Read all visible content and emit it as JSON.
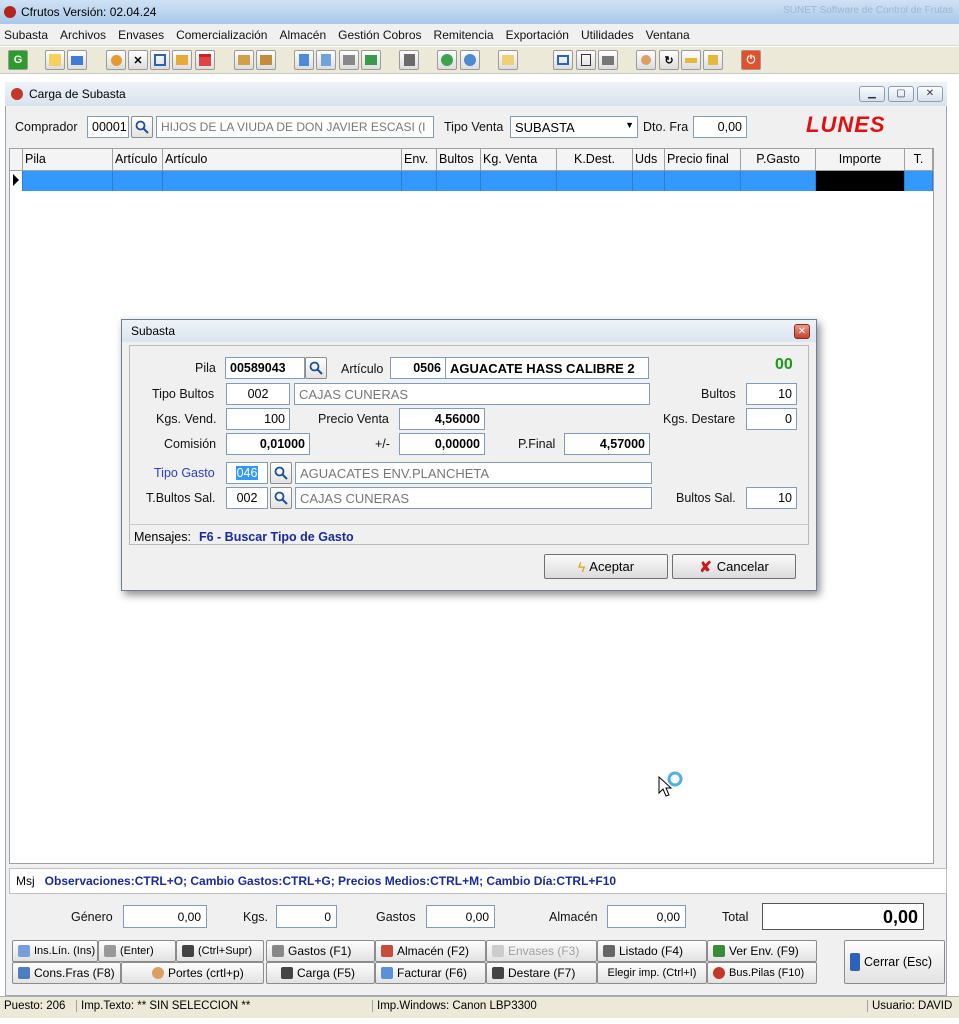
{
  "app": {
    "title": "Cfrutos Versión: 02.04.24",
    "faded_title": "SUNET Software de Control de Frutas"
  },
  "menu": [
    "Subasta",
    "Archivos",
    "Envases",
    "Comercialización",
    "Almacén",
    "Gestión Cobros",
    "Remitencia",
    "Exportación",
    "Utilidades",
    "Ventana"
  ],
  "window": {
    "title": "Carga de Subasta"
  },
  "header": {
    "comprador_label": "Comprador",
    "comprador_code": "00001",
    "comprador_name": "HIJOS DE LA VIUDA DE DON JAVIER ESCASI (I",
    "tipo_venta_label": "Tipo Venta",
    "tipo_venta_value": "SUBASTA",
    "dto_label": "Dto. Fra",
    "dto_value": "0,00",
    "day": "LUNES"
  },
  "grid": {
    "columns": [
      "Pila",
      "Artículo",
      "Artículo",
      "Env.",
      "Bultos",
      "Kg. Venta",
      "K.Dest.",
      "Uds",
      "Precio final",
      "P.Gasto",
      "Importe",
      "T."
    ]
  },
  "dialog": {
    "title": "Subasta",
    "close_glyph": "✕",
    "pila_label": "Pila",
    "pila_value": "00589043",
    "articulo_label": "Artículo",
    "articulo_code": "0506",
    "articulo_name": "AGUACATE HASS CALIBRE 2",
    "counter": "00",
    "tipo_bultos_label": "Tipo Bultos",
    "tipo_bultos_code": "002",
    "tipo_bultos_name": "CAJAS CUNERAS",
    "bultos_label": "Bultos",
    "bultos_value": "10",
    "kgs_vend_label": "Kgs. Vend.",
    "kgs_vend_value": "100",
    "precio_venta_label": "Precio Venta",
    "precio_venta_value": "4,56000",
    "kgs_destare_label": "Kgs. Destare",
    "kgs_destare_value": "0",
    "comision_label": "Comisión",
    "comision_value": "0,01000",
    "plusminus_label": "+/-",
    "plusminus_value": "0,00000",
    "pfinal_label": "P.Final",
    "pfinal_value": "4,57000",
    "tipo_gasto_label": "Tipo Gasto",
    "tipo_gasto_code": "046",
    "tipo_gasto_name": "AGUACATES ENV.PLANCHETA",
    "tbultos_sal_label": "T.Bultos Sal.",
    "tbultos_sal_code": "002",
    "tbultos_sal_name": "CAJAS CUNERAS",
    "bultos_sal_label": "Bultos Sal.",
    "bultos_sal_value": "10",
    "mensajes_label": "Mensajes:",
    "mensajes_value": "F6 - Buscar Tipo de Gasto",
    "aceptar": "Aceptar",
    "cancelar": "Cancelar"
  },
  "msj": {
    "label": "Msj",
    "text": "Observaciones:CTRL+O;  Cambio Gastos:CTRL+G;  Precios Medios:CTRL+M;  Cambio Día:CTRL+F10"
  },
  "totals": {
    "genero_label": "Género",
    "genero": "0,00",
    "kgs_label": "Kgs.",
    "kgs": "0",
    "gastos_label": "Gastos",
    "gastos": "0,00",
    "almacen_label": "Almacén",
    "almacen": "0,00",
    "total_label": "Total",
    "total": "0,00"
  },
  "buttons": {
    "ins_lin": "Ins.Lín. (Ins)",
    "enter": "(Enter)",
    "supr": "(Ctrl+Supr)",
    "gastos": "Gastos (F1)",
    "almacen": "Almacén (F2)",
    "envases": "Envases (F3)",
    "listado": "Listado (F4)",
    "ver_env": "Ver Env. (F9)",
    "cons_fras": "Cons.Fras (F8)",
    "portes": "Portes (crtl+p)",
    "carga": "Carga (F5)",
    "facturar": "Facturar (F6)",
    "destare": "Destare (F7)",
    "elegir_imp": "Elegir imp. (Ctrl+I)",
    "bus_pilas": "Bus.Pilas (F10)",
    "cerrar": "Cerrar (Esc)"
  },
  "status": {
    "puesto": "Puesto: 206",
    "imp_texto": "Imp.Texto: ** SIN SELECCION **",
    "imp_windows": "Imp.Windows: Canon LBP3300",
    "usuario": "Usuario: DAVID"
  },
  "colors": {
    "accent": "#3399ff",
    "day": "#e01010",
    "counter": "#1a9a1a",
    "link_label": "#2a3fbf",
    "msg": "#1a2a9c"
  }
}
